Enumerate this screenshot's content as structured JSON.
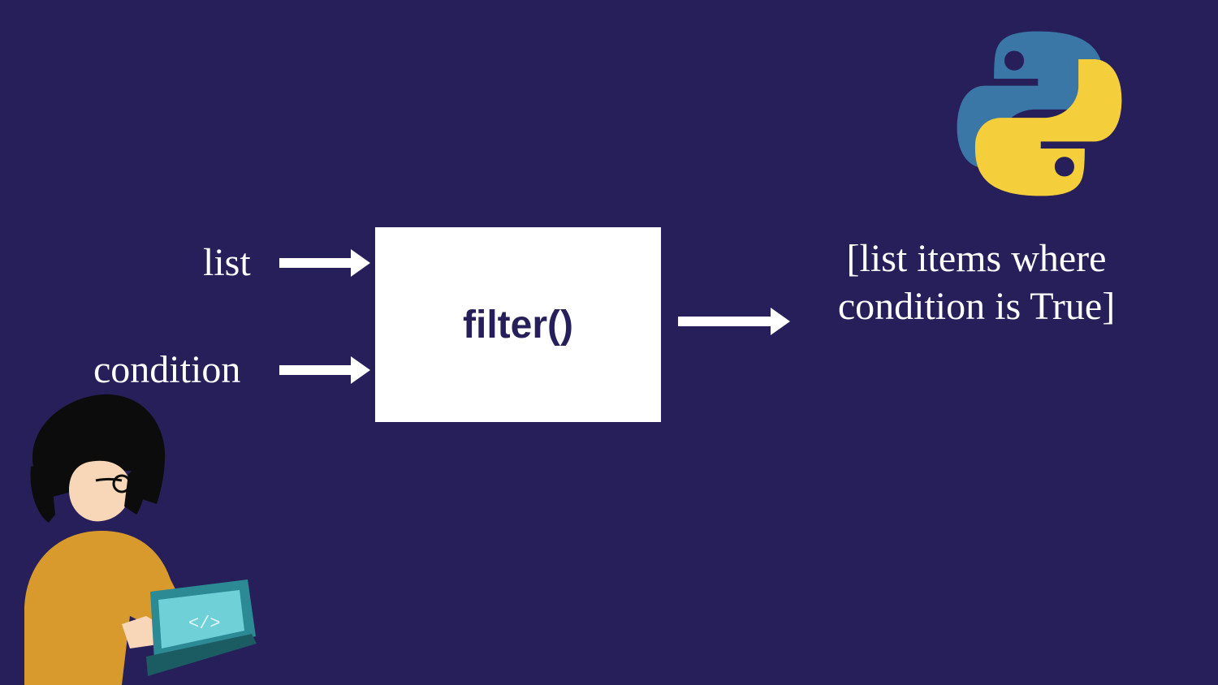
{
  "inputs": {
    "list_label": "list",
    "condition_label": "condition"
  },
  "box": {
    "label": "filter()"
  },
  "output": {
    "text": "[list items where condition is True]"
  },
  "icons": {
    "python": "python-logo-icon",
    "coder": "coder-illustration-icon"
  },
  "colors": {
    "bg": "#261f59",
    "box_bg": "#ffffff",
    "text": "#ffffff",
    "box_text": "#261f59",
    "py_blue": "#3a76a6",
    "py_yellow": "#f5cf3b"
  }
}
